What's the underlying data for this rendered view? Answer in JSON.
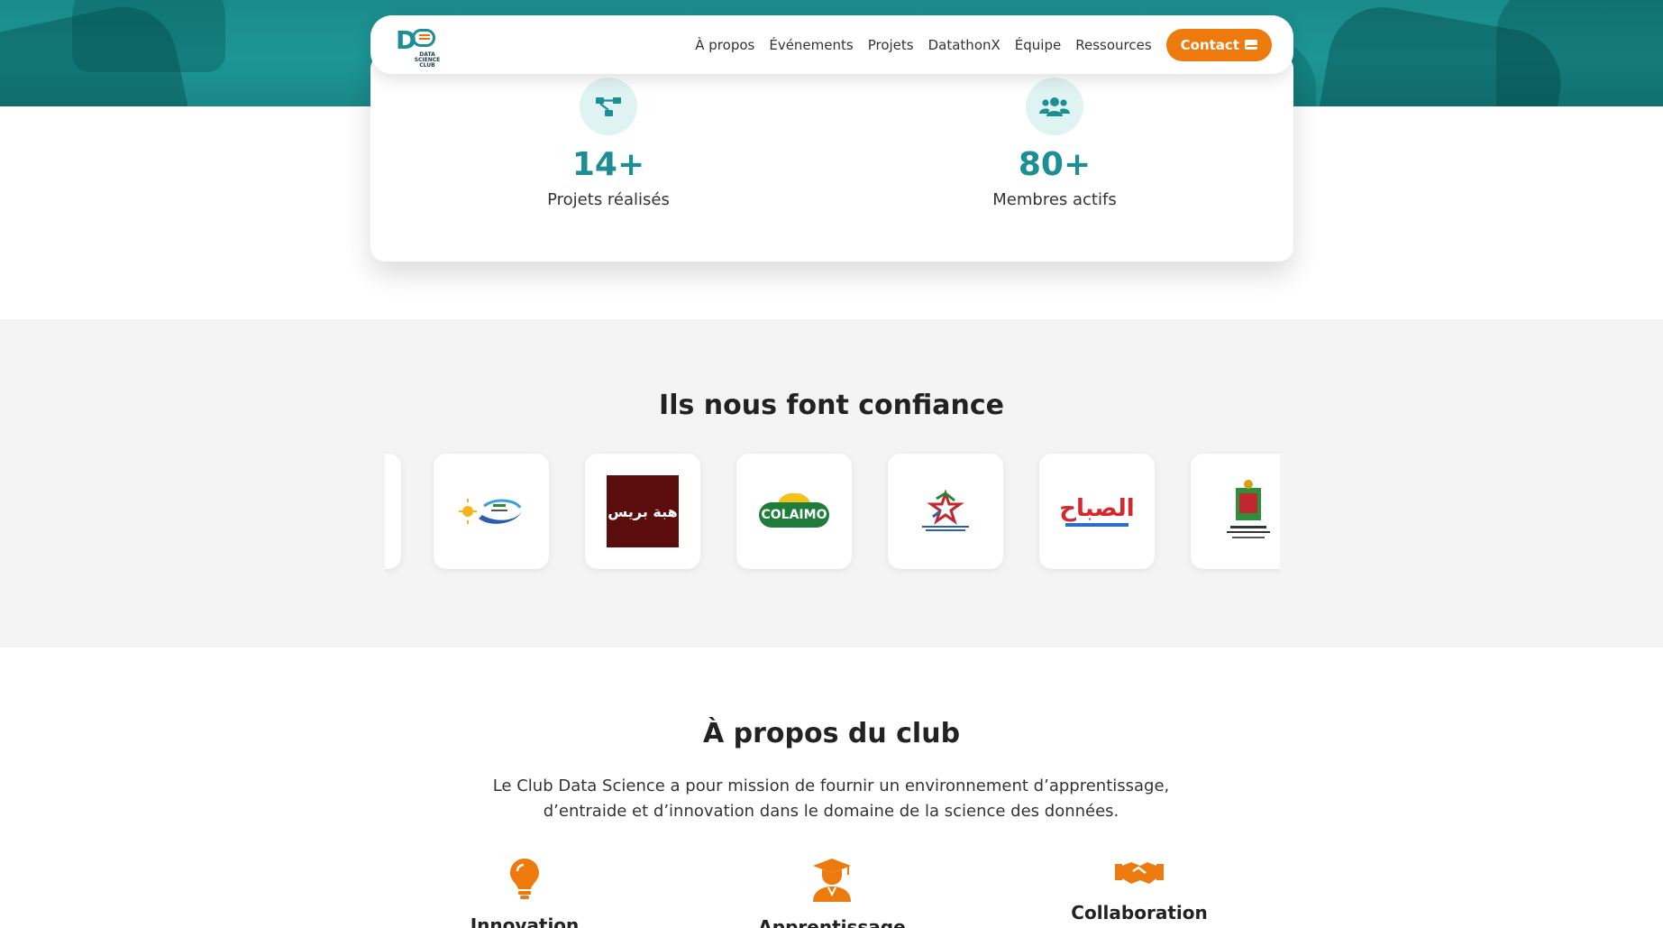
{
  "nav": {
    "links": [
      "À propos",
      "Événements",
      "Projets",
      "DatathonX",
      "Équipe",
      "Ressources"
    ],
    "contact_label": "Contact",
    "logo_text": "DATA SCIENCE CLUB"
  },
  "stats": [
    {
      "value": "14+",
      "label": "Projets réalisés",
      "icon": "project-diagram-icon"
    },
    {
      "value": "80+",
      "label": "Membres actifs",
      "icon": "users-icon"
    }
  ],
  "partners": {
    "title": "Ils nous font confiance",
    "logos": [
      {
        "name": "partner-logo-regional-council",
        "text": ""
      },
      {
        "name": "partner-logo-hiba-press",
        "text": "هبة بريس"
      },
      {
        "name": "partner-logo-colaimo",
        "text": "COLAIMO"
      },
      {
        "name": "partner-logo-snrt",
        "text": ""
      },
      {
        "name": "partner-logo-assabah",
        "text": "الصباح"
      },
      {
        "name": "partner-logo-commune-oujda",
        "text": ""
      }
    ]
  },
  "about": {
    "title": "À propos du club",
    "text_line1": "Le Club Data Science a pour mission de fournir un environnement d’apprentissage,",
    "text_line2": "d’entraide et d’innovation dans le domaine de la science des données.",
    "features": [
      {
        "label": "Innovation",
        "icon": "lightbulb-icon"
      },
      {
        "label": "Apprentissage",
        "icon": "graduate-icon"
      },
      {
        "label": "Collaboration",
        "icon": "handshake-icon"
      }
    ]
  },
  "colors": {
    "teal": "#1b8f94",
    "orange": "#ec7a0d"
  }
}
